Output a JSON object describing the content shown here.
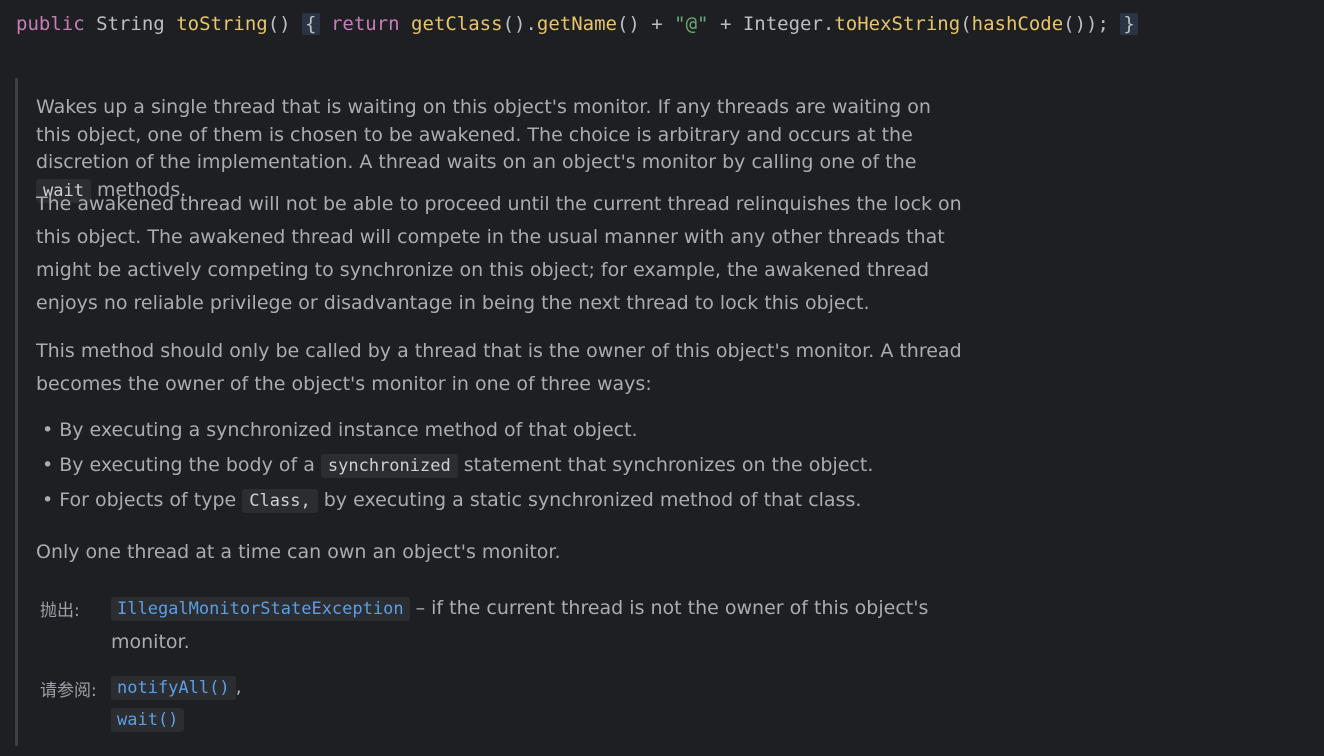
{
  "code_line": {
    "public": "public",
    "type": "String",
    "method": "toString",
    "parens": "()",
    "open_brace": "{",
    "return": "return",
    "getClass": "getClass",
    "dot1": "().",
    "getName": "getName",
    "plus1": "() + ",
    "str": "\"@\"",
    "plus2": " + Integer.",
    "toHex": "toHexString",
    "lp": "(",
    "hashCode": "hashCode",
    "tail": "());",
    "close_brace": "}"
  },
  "doc": {
    "p1_a": "Wakes up a single thread that is waiting on this object's monitor. If any threads are waiting on this object, one of them is chosen to be awakened. The choice is arbitrary and occurs at the discretion of the implementation. A thread waits on an object's monitor by calling one of the ",
    "p1_code": "wait",
    "p1_b": " methods.",
    "p2": "The awakened thread will not be able to proceed until the current thread relinquishes the lock on this object. The awakened thread will compete in the usual manner with any other threads that might be actively competing to synchronize on this object; for example, the awakened thread enjoys no reliable privilege or disadvantage in being the next thread to lock this object.",
    "p3": "This method should only be called by a thread that is the owner of this object's monitor. A thread becomes the owner of the object's monitor in one of three ways:",
    "bullets": {
      "b1": "By executing a synchronized instance method of that object.",
      "b2_a": "By executing the body of a ",
      "b2_code": "synchronized",
      "b2_b": " statement that synchronizes on the object.",
      "b3_a": "For objects of type ",
      "b3_code": "Class,",
      "b3_b": " by executing a static synchronized method of that class."
    },
    "p4": "Only one thread at a time can own an object's monitor.",
    "throws_label": "抛出:",
    "throws_link": "IllegalMonitorStateException",
    "throws_text": " – if the current thread is not the owner of this object's monitor.",
    "seealso_label": "请参阅:",
    "seealso_link1": "notifyAll()",
    "seealso_sep": ",",
    "seealso_link2": "wait()"
  }
}
